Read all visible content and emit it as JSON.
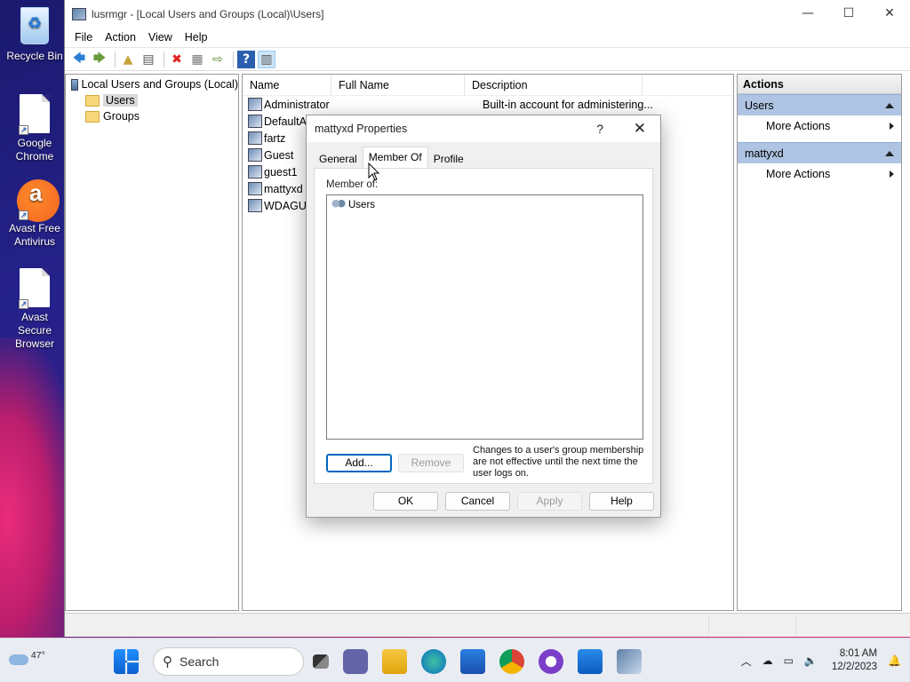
{
  "desktop": {
    "icons": [
      {
        "label": "Recycle Bin",
        "icon": "recycle-bin-icon"
      },
      {
        "label": "Google Chrome",
        "icon": "chrome-shortcut-icon"
      },
      {
        "label": "Avast Free Antivirus",
        "icon": "avast-icon"
      },
      {
        "label": "Avast Secure Browser",
        "icon": "avast-browser-shortcut-icon"
      }
    ]
  },
  "window": {
    "title": "lusrmgr - [Local Users and Groups (Local)\\Users]",
    "controls": {
      "minimize": "—",
      "maximize": "☐",
      "close": "✕"
    }
  },
  "menu": {
    "file": "File",
    "action": "Action",
    "view": "View",
    "help": "Help"
  },
  "tree": {
    "root": "Local Users and Groups (Local)",
    "items": [
      "Users",
      "Groups"
    ]
  },
  "list": {
    "headers": {
      "name": "Name",
      "full_name": "Full Name",
      "description": "Description"
    },
    "rows": [
      {
        "name": "Administrator",
        "full_name": "",
        "description": "Built-in account for administering..."
      },
      {
        "name": "DefaultAc",
        "full_name": "",
        "description": ""
      },
      {
        "name": "fartz",
        "full_name": "",
        "description": ""
      },
      {
        "name": "Guest",
        "full_name": "",
        "description": ""
      },
      {
        "name": "guest1",
        "full_name": "",
        "description": ""
      },
      {
        "name": "mattyxd",
        "full_name": "",
        "description": ""
      },
      {
        "name": "WDAGUti",
        "full_name": "",
        "description": ""
      }
    ]
  },
  "actions": {
    "header": "Actions",
    "sections": [
      {
        "title": "Users",
        "item": "More Actions"
      },
      {
        "title": "mattyxd",
        "item": "More Actions"
      }
    ]
  },
  "dialog": {
    "title": "mattyxd Properties",
    "help_glyph": "?",
    "close_glyph": "✕",
    "tabs": [
      "General",
      "Member Of",
      "Profile"
    ],
    "active_tab": "Member Of",
    "member_of_label": "Member of:",
    "members": [
      "Users"
    ],
    "add_button": "Add...",
    "remove_button": "Remove",
    "note": "Changes to a user's group membership are not effective until the next time the user logs on.",
    "ok": "OK",
    "cancel": "Cancel",
    "apply": "Apply",
    "help": "Help"
  },
  "taskbar": {
    "weather": "47°",
    "search_placeholder": "Search",
    "time": "8:01 AM",
    "date": "12/2/2023"
  }
}
